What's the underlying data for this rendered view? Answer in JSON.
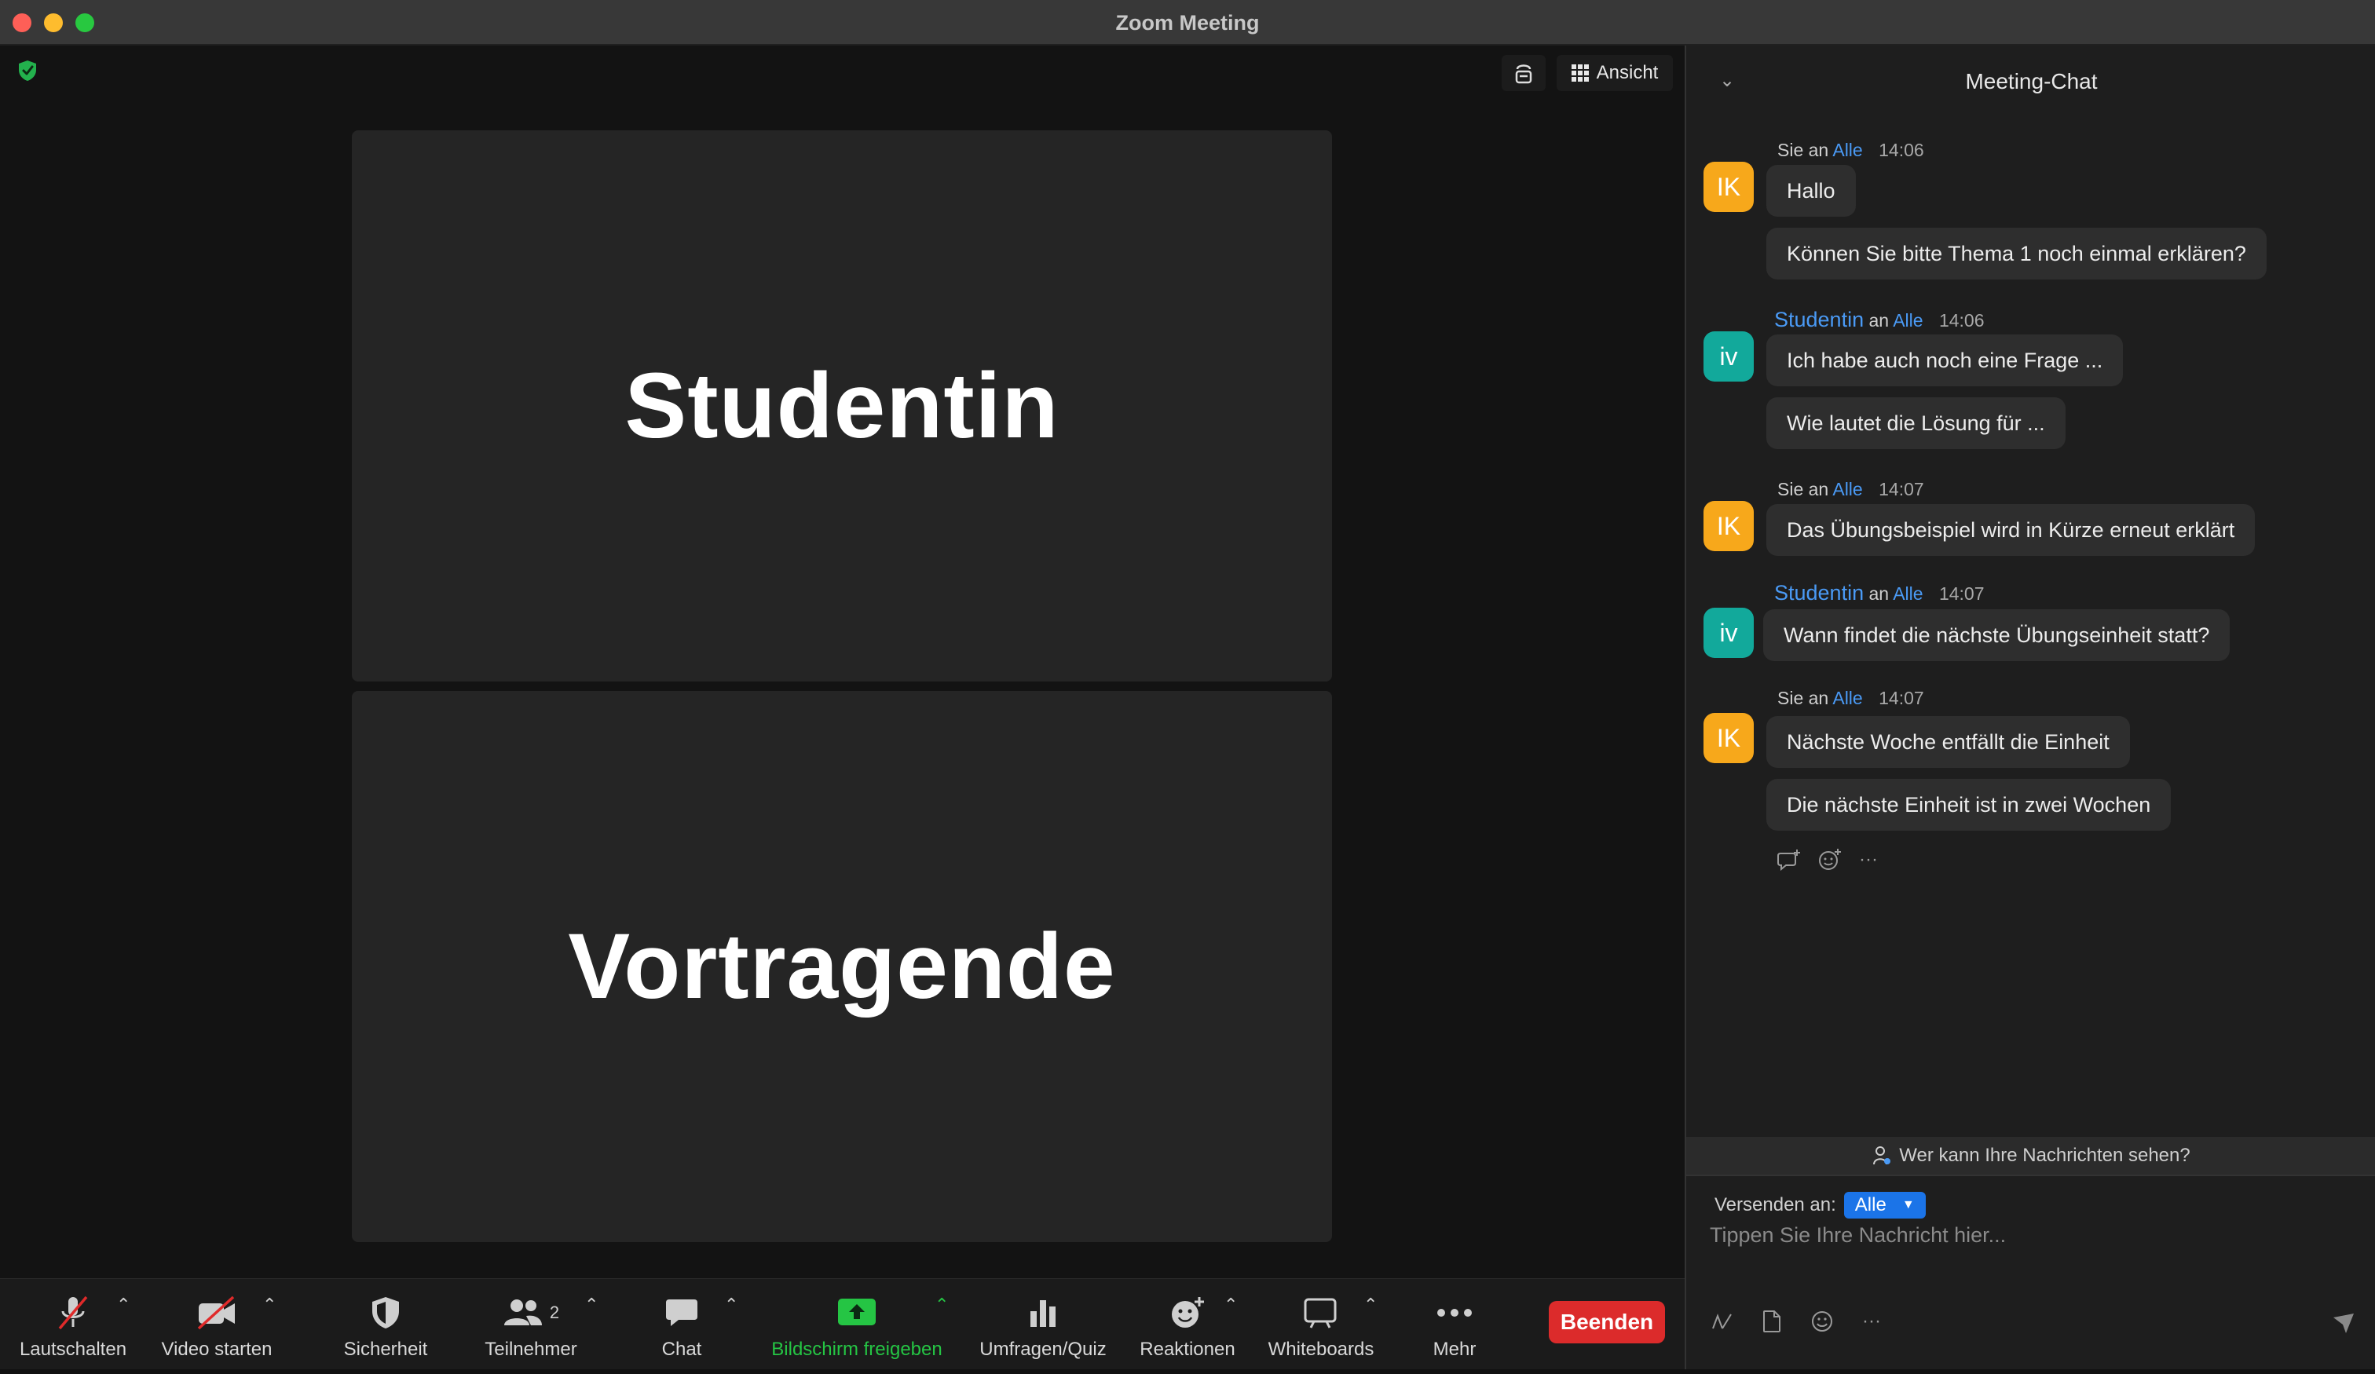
{
  "window": {
    "title": "Zoom Meeting"
  },
  "stage": {
    "view_button_label": "Ansicht",
    "tiles": [
      {
        "name": "Studentin"
      },
      {
        "name": "Vortragende"
      }
    ]
  },
  "toolbar": {
    "mute_label": "Lautschalten",
    "video_label": "Video starten",
    "security_label": "Sicherheit",
    "participants_label": "Teilnehmer",
    "participants_count": "2",
    "chat_label": "Chat",
    "share_label": "Bildschirm freigeben",
    "polls_label": "Umfragen/Quiz",
    "reactions_label": "Reaktionen",
    "whiteboards_label": "Whiteboards",
    "more_label": "Mehr",
    "end_label": "Beenden",
    "share_color": "#25c544",
    "end_color": "#dc2b2b"
  },
  "chat": {
    "title": "Meeting-Chat",
    "visibility_text": "Wer kann Ihre Nachrichten sehen?",
    "send_to_label": "Versenden an:",
    "recipient": "Alle",
    "input_placeholder": "Tippen Sie Ihre Nachricht hier...",
    "groups": [
      {
        "avatar": "IK",
        "sender": "Sie",
        "connector": "an",
        "to": "Alle",
        "time": "14:06",
        "messages": [
          "Hallo",
          "Können Sie bitte Thema 1 noch einmal erklären?"
        ]
      },
      {
        "avatar": "iv",
        "sender": "Studentin",
        "connector": "an",
        "to": "Alle",
        "time": "14:06",
        "messages": [
          "Ich habe auch noch eine Frage ...",
          "Wie lautet die Lösung für ..."
        ]
      },
      {
        "avatar": "IK",
        "sender": "Sie",
        "connector": "an",
        "to": "Alle",
        "time": "14:07",
        "messages": [
          "Das Übungsbeispiel wird in Kürze erneut erklärt"
        ]
      },
      {
        "avatar": "iv",
        "sender": "Studentin",
        "connector": "an",
        "to": "Alle",
        "time": "14:07",
        "messages": [
          "Wann findet die nächste Übungseinheit statt?"
        ]
      },
      {
        "avatar": "IK",
        "sender": "Sie",
        "connector": "an",
        "to": "Alle",
        "time": "14:07",
        "messages": [
          "Nächste Woche entfällt die Einheit",
          "Die nächste Einheit ist in zwei Wochen"
        ]
      }
    ],
    "message_actions_more": "···",
    "composer_more": "···",
    "avatar_colors": {
      "IK": "#f7a81b",
      "iv": "#12a99b"
    },
    "link_color": "#4a9af5"
  }
}
